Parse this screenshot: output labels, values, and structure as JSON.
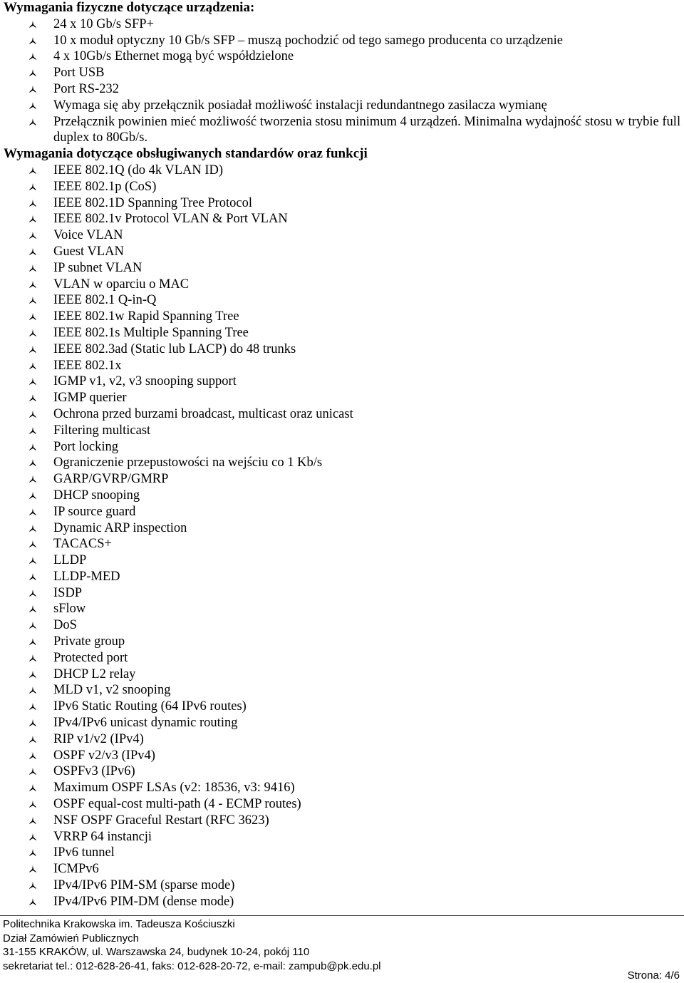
{
  "sections": [
    {
      "heading": "Wymagania fizyczne dotyczące urządzenia:",
      "items": [
        "24 x 10 Gb/s SFP+",
        "10 x moduł optyczny 10 Gb/s SFP – muszą pochodzić od tego samego producenta co urządzenie",
        "4 x 10Gb/s Ethernet mogą być współdzielone",
        "Port USB",
        "Port RS-232",
        "Wymaga się aby przełącznik posiadał możliwość instalacji redundantnego zasilacza wymianę",
        "Przełącznik powinien mieć możliwość tworzenia stosu minimum 4 urządzeń. Minimalna wydajność stosu w trybie full duplex to 80Gb/s."
      ]
    },
    {
      "heading": "Wymagania dotyczące obsługiwanych standardów oraz funkcji",
      "items": [
        "IEEE 802.1Q (do 4k VLAN ID)",
        "IEEE 802.1p (CoS)",
        "IEEE 802.1D Spanning Tree Protocol",
        "IEEE 802.1v Protocol VLAN & Port VLAN",
        "Voice VLAN",
        "Guest VLAN",
        "IP subnet VLAN",
        "VLAN w oparciu o MAC",
        "IEEE 802.1 Q-in-Q",
        "IEEE 802.1w Rapid Spanning Tree",
        "IEEE 802.1s Multiple Spanning Tree",
        "IEEE 802.3ad (Static lub LACP) do 48 trunks",
        "IEEE 802.1x",
        "IGMP v1, v2, v3 snooping support",
        "IGMP querier",
        "Ochrona przed burzami broadcast, multicast oraz unicast",
        "Filtering multicast",
        "Port locking",
        "Ograniczenie przepustowości na wejściu co 1 Kb/s",
        "GARP/GVRP/GMRP",
        "DHCP snooping",
        "IP source guard",
        "Dynamic ARP inspection",
        "TACACS+",
        "LLDP",
        "LLDP-MED",
        "ISDP",
        "sFlow",
        "DoS",
        "Private group",
        "Protected port",
        "DHCP L2 relay",
        "MLD v1, v2 snooping",
        "IPv6 Static Routing (64 IPv6 routes)",
        "IPv4/IPv6 unicast dynamic routing",
        "RIP v1/v2 (IPv4)",
        "OSPF v2/v3 (IPv4)",
        "OSPFv3 (IPv6)",
        "Maximum OSPF LSAs (v2: 18536, v3: 9416)",
        "OSPF equal-cost multi-path (4 - ECMP routes)",
        "NSF OSPF Graceful Restart (RFC 3623)",
        "VRRP 64 instancji",
        "IPv6 tunnel",
        "ICMPv6",
        "IPv4/IPv6 PIM-SM (sparse mode)",
        "IPv4/IPv6 PIM-DM (dense mode)"
      ]
    }
  ],
  "bullet_icon": "arrowhead-bullet-icon",
  "footer": {
    "lines": [
      "Politechnika Krakowska im. Tadeusza Kościuszki",
      "Dział Zamówień Publicznych",
      "31-155 KRAKÓW, ul. Warszawska 24, budynek 10-24, pokój 110",
      "sekretariat tel.: 012-628-26-41, faks: 012-628-20-72, e-mail: zampub@pk.edu.pl"
    ],
    "page_number": "Strona: 4/6"
  }
}
